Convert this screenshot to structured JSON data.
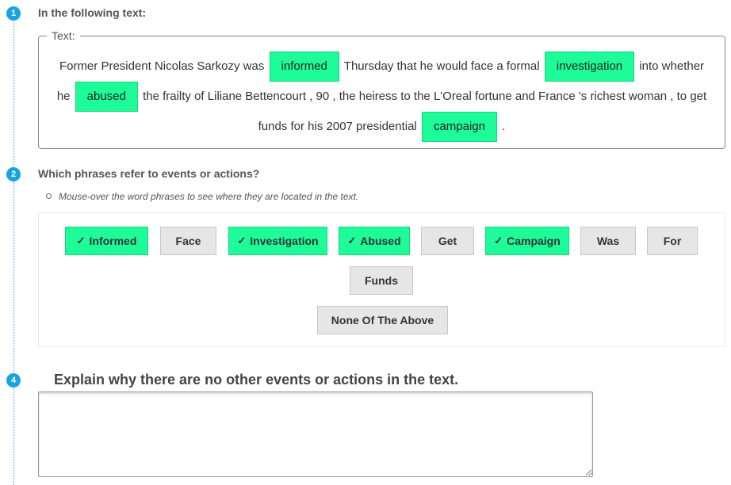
{
  "steps": [
    {
      "number": "1",
      "title": "In the following text:"
    },
    {
      "number": "2",
      "title": "Which phrases refer to events or actions?"
    },
    {
      "number": "4",
      "title": "Explain why there are no other events or actions in the text."
    }
  ],
  "text_box": {
    "legend": "Text:",
    "line1": {
      "a": "Former President Nicolas Sarkozy was",
      "h1": "informed",
      "b": "Thursday that he would face a formal",
      "h2": "investigation",
      "c": "into whether"
    },
    "line2": {
      "a": "he",
      "h1": "abused",
      "b": "the frailty of Liliane Bettencourt , 90 , the heiress to the L'Oreal fortune and France 's richest woman , to get"
    },
    "line3": {
      "a": "funds for his 2007 presidential",
      "h1": "campaign",
      "b": "."
    }
  },
  "hint": "Mouse-over the word phrases to see where they are located in the text.",
  "choices": [
    {
      "label": "Informed",
      "selected": true
    },
    {
      "label": "Face",
      "selected": false
    },
    {
      "label": "Investigation",
      "selected": true
    },
    {
      "label": "Abused",
      "selected": true
    },
    {
      "label": "Get",
      "selected": false
    },
    {
      "label": "Campaign",
      "selected": true
    },
    {
      "label": "Was",
      "selected": false
    },
    {
      "label": "For",
      "selected": false
    },
    {
      "label": "Funds",
      "selected": false
    },
    {
      "label": "None Of The Above",
      "selected": false
    }
  ],
  "explanation": {
    "value": ""
  },
  "colors": {
    "accent": "#18a4e0",
    "selected": "#1dfc98",
    "unselected": "#e6e6e6"
  }
}
